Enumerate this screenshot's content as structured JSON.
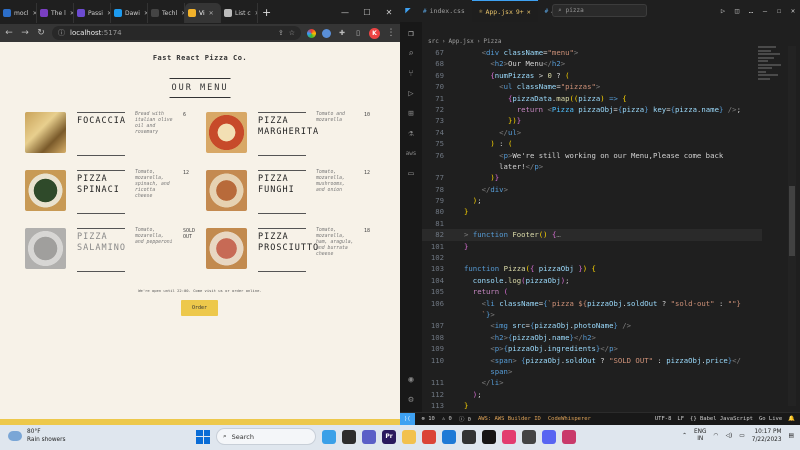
{
  "browser": {
    "tabs": [
      {
        "label": "mocl",
        "color": "#2c6ec9"
      },
      {
        "label": "The l",
        "color": "#7a3fc2"
      },
      {
        "label": "Passi",
        "color": "#6c4bd1"
      },
      {
        "label": "Dawi",
        "color": "#1d9bf0"
      },
      {
        "label": "Techl",
        "color": "#444444"
      },
      {
        "label": "Vi",
        "color": "#f2b22b",
        "active": true
      },
      {
        "label": "List c",
        "color": "#bbbbbb"
      }
    ],
    "url_host": "localhost",
    "url_port": ":5174"
  },
  "page": {
    "brand": "Fast React Pizza Co.",
    "menu_title": "OUR MENU",
    "pizzas": [
      {
        "name": "FOCACCIA",
        "ingredients": "Bread with italian olive oil and rosemary",
        "price": "6",
        "sold_out": false
      },
      {
        "name": "PIZZA MARGHERITA",
        "ingredients": "Tomato and mozarella",
        "price": "10",
        "sold_out": false
      },
      {
        "name": "PIZZA SPINACI",
        "ingredients": "Tomato, mozarella, spinach, and ricotta cheese",
        "price": "12",
        "sold_out": false
      },
      {
        "name": "PIZZA FUNGHI",
        "ingredients": "Tomato, mozarella, mushrooms, and onion",
        "price": "12",
        "sold_out": false
      },
      {
        "name": "PIZZA SALAMINO",
        "ingredients": "Tomato, mozarella, and pepperoni",
        "price": "SOLD OUT",
        "sold_out": true
      },
      {
        "name": "PIZZA PROSCIUTTO",
        "ingredients": "Tomato, mozarella, ham, aragula, and burrata cheese",
        "price": "18",
        "sold_out": false
      }
    ],
    "footer_message": "We're open until 22:00. Come visit us or order online.",
    "order_button": "Order"
  },
  "vscode": {
    "tabs": [
      {
        "label": "index.css",
        "kind": "css"
      },
      {
        "label": "App.jsx",
        "kind": "jsx",
        "active": true,
        "badge": "9+"
      },
      {
        "label": "App.css",
        "kind": "css"
      }
    ],
    "search": "pizza",
    "breadcrumb": [
      "src",
      "App.jsx",
      "Pizza"
    ],
    "code_lines": [
      {
        "n": "67",
        "html": "    <span class='pu'>&lt;</span><span class='tg'>div</span> <span class='at'>className</span>=<span class='st'>\"menu\"</span><span class='pu'>&gt;</span>"
      },
      {
        "n": "68",
        "html": "      <span class='pu'>&lt;</span><span class='tg'>h2</span><span class='pu'>&gt;</span>Our Menu<span class='pu'>&lt;/</span><span class='tg'>h2</span><span class='pu'>&gt;</span>"
      },
      {
        "n": "69",
        "html": "      <span class='bb'>{</span><span class='at'>numPizzas</span> &gt; <span class='fn'>0</span> ? <span class='br'>(</span>"
      },
      {
        "n": "70",
        "html": "        <span class='pu'>&lt;</span><span class='tg'>ul</span> <span class='at'>className</span>=<span class='st'>\"pizzas\"</span><span class='pu'>&gt;</span>"
      },
      {
        "n": "71",
        "html": "          <span class='bb'>{</span><span class='at'>pizzaData</span>.<span class='fn'>map</span><span class='br'>((</span><span class='at'>pizza</span><span class='br'>)</span> <span class='tg'>=&gt;</span> <span class='br'>{</span>"
      },
      {
        "n": "72",
        "html": "            <span class='kw'>return</span> <span class='pu'>&lt;</span><span class='cm'>Pizza</span> <span class='at'>pizzaObj</span>=<span class='tg'>{</span><span class='at'>pizza</span><span class='tg'>}</span> <span class='at'>key</span>=<span class='tg'>{</span><span class='at'>pizza</span>.<span class='at'>name</span><span class='tg'>}</span> <span class='pu'>/&gt;</span>;"
      },
      {
        "n": "73",
        "html": "          <span class='br'>})</span><span class='bb'>}</span>"
      },
      {
        "n": "74",
        "html": "        <span class='pu'>&lt;/</span><span class='tg'>ul</span><span class='pu'>&gt;</span>"
      },
      {
        "n": "75",
        "html": "      <span class='br'>)</span> : <span class='br'>(</span>"
      },
      {
        "n": "76",
        "html": "        <span class='pu'>&lt;</span><span class='tg'>p</span><span class='pu'>&gt;</span>We're still working on our Menu,Please come back"
      },
      {
        "n": "",
        "html": "        later!<span class='pu'>&lt;/</span><span class='tg'>p</span><span class='pu'>&gt;</span>"
      },
      {
        "n": "77",
        "html": "      <span class='br'>)</span><span class='bb'>}</span>"
      },
      {
        "n": "78",
        "html": "    <span class='pu'>&lt;/</span><span class='tg'>div</span><span class='pu'>&gt;</span>"
      },
      {
        "n": "79",
        "html": "  <span class='br'>)</span>;"
      },
      {
        "n": "80",
        "html": "<span class='br'>}</span>"
      },
      {
        "n": "81",
        "html": ""
      },
      {
        "n": "82",
        "html": "<span class='pu'>&gt;</span> <span class='tg'>function</span> <span class='fn'>Footer</span><span class='br'>()</span> <span class='bb'>{</span><span class='pu'>…</span>",
        "hl": true
      },
      {
        "n": "101",
        "html": "<span class='bb'>}</span>"
      },
      {
        "n": "102",
        "html": ""
      },
      {
        "n": "103",
        "html": "<span class='tg'>function</span> <span class='fn'>Pizza</span><span class='br'>(</span><span class='bb'>{</span> <span class='at'>pizzaObj</span> <span class='bb'>}</span><span class='br'>)</span> <span class='br'>{</span>"
      },
      {
        "n": "104",
        "html": "  <span class='at'>console</span>.<span class='fn'>log</span><span class='bb'>(</span><span class='at'>pizzaObj</span><span class='bb'>)</span>;"
      },
      {
        "n": "105",
        "html": "  <span class='kw'>return</span> <span class='bb'>(</span>"
      },
      {
        "n": "106",
        "html": "    <span class='pu'>&lt;</span><span class='tg'>li</span> <span class='at'>className</span>=<span class='tg'>{</span><span class='st'>`pizza ${</span><span class='at'>pizzaObj</span>.<span class='at'>soldOut</span> ? <span class='st'>\"sold-out\"</span> : <span class='st'>\"\"</span><span class='st'>}</span>"
      },
      {
        "n": "",
        "html": "    <span class='st'>`</span><span class='tg'>}</span><span class='pu'>&gt;</span>"
      },
      {
        "n": "107",
        "html": "      <span class='pu'>&lt;</span><span class='tg'>img</span> <span class='at'>src</span>=<span class='tg'>{</span><span class='at'>pizzaObj</span>.<span class='at'>photoName</span><span class='tg'>}</span> <span class='pu'>/&gt;</span>"
      },
      {
        "n": "108",
        "html": "      <span class='pu'>&lt;</span><span class='tg'>h2</span><span class='pu'>&gt;</span><span class='tg'>{</span><span class='at'>pizzaObj</span>.<span class='at'>name</span><span class='tg'>}</span><span class='pu'>&lt;/</span><span class='tg'>h2</span><span class='pu'>&gt;</span>"
      },
      {
        "n": "109",
        "html": "      <span class='pu'>&lt;</span><span class='tg'>p</span><span class='pu'>&gt;</span><span class='tg'>{</span><span class='at'>pizzaObj</span>.<span class='at'>ingredients</span><span class='tg'>}</span><span class='pu'>&lt;/</span><span class='tg'>p</span><span class='pu'>&gt;</span>"
      },
      {
        "n": "110",
        "html": "      <span class='pu'>&lt;</span><span class='tg'>span</span><span class='pu'>&gt;</span> <span class='tg'>{</span><span class='at'>pizzaObj</span>.<span class='at'>soldOut</span> ? <span class='st'>\"SOLD OUT\"</span> : <span class='at'>pizzaObj</span>.<span class='at'>price</span><span class='tg'>}</span><span class='pu'>&lt;/</span>"
      },
      {
        "n": "",
        "html": "      <span class='tg'>span</span><span class='pu'>&gt;</span>"
      },
      {
        "n": "111",
        "html": "    <span class='pu'>&lt;/</span><span class='tg'>li</span><span class='pu'>&gt;</span>"
      },
      {
        "n": "112",
        "html": "  <span class='bb'>)</span>;"
      },
      {
        "n": "113",
        "html": "<span class='br'>}</span>"
      }
    ],
    "status": {
      "errors": "⊗ 10",
      "warnings": "⚠ 0",
      "info": "ⓘ 0",
      "aws": "AWS: AWS Builder ID",
      "codewhisperer": "CodeWhisperer",
      "encoding": "UTF-8",
      "eol": "LF",
      "language": "{} Babel JavaScript",
      "golive": "Go Live"
    }
  },
  "taskbar": {
    "temperature": "80°F",
    "weather": "Rain showers",
    "search_placeholder": "Search",
    "language_top": "ENG",
    "language_bottom": "IN",
    "time": "10:17 PM",
    "date": "7/22/2023",
    "apps": [
      {
        "name": "copilot",
        "color": "#3aa0e8"
      },
      {
        "name": "files",
        "color": "#2d2d2d"
      },
      {
        "name": "meet",
        "color": "#5b5fc7"
      },
      {
        "name": "premiere",
        "color": "#2a1a5e",
        "glyph": "Pr"
      },
      {
        "name": "explorer",
        "color": "#f2c14e"
      },
      {
        "name": "chrome",
        "color": "#db4437"
      },
      {
        "name": "vscode",
        "color": "#1f7ad6"
      },
      {
        "name": "app-dark",
        "color": "#333333"
      },
      {
        "name": "github",
        "color": "#171515"
      },
      {
        "name": "intellij",
        "color": "#e33c6f"
      },
      {
        "name": "figma",
        "color": "#444444"
      },
      {
        "name": "discord",
        "color": "#5865f2"
      },
      {
        "name": "snipping",
        "color": "#c93a6a"
      }
    ]
  }
}
